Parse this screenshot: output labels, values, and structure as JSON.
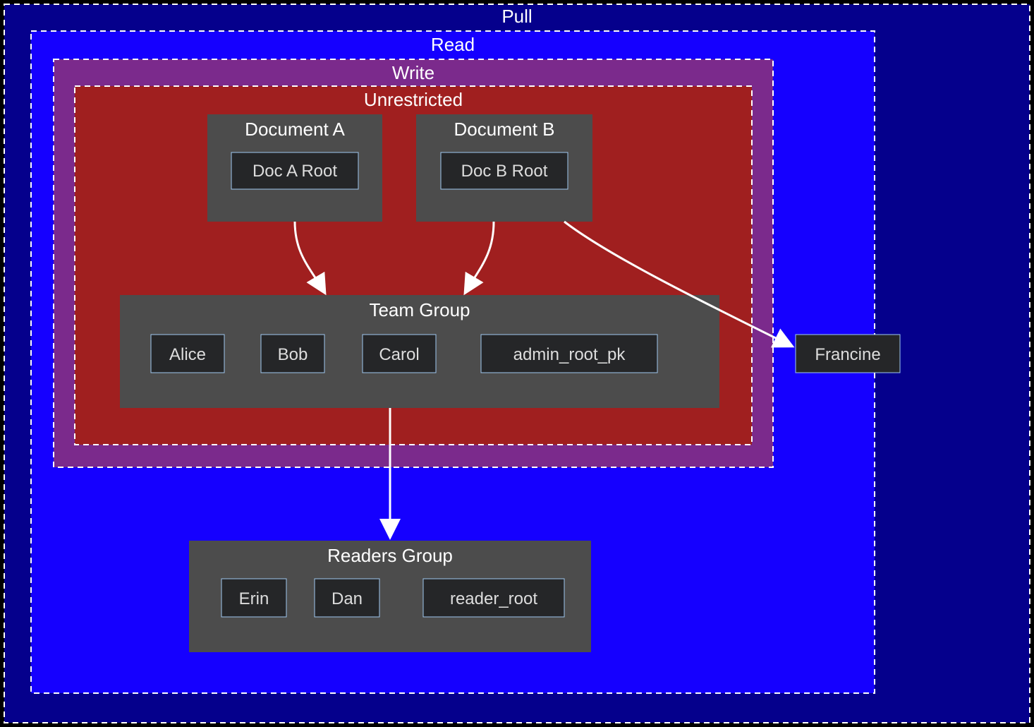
{
  "levels": {
    "pull": {
      "label": "Pull",
      "color": "#05008c"
    },
    "read": {
      "label": "Read",
      "color": "#1500ff"
    },
    "write": {
      "label": "Write",
      "color": "#7b2a8c"
    },
    "unrestricted": {
      "label": "Unrestricted",
      "color": "#a01f1f"
    }
  },
  "docA": {
    "title": "Document A",
    "root": "Doc A Root"
  },
  "docB": {
    "title": "Document B",
    "root": "Doc B Root"
  },
  "teamGroup": {
    "title": "Team Group",
    "members": [
      "Alice",
      "Bob",
      "Carol",
      "admin_root_pk"
    ]
  },
  "readersGroup": {
    "title": "Readers Group",
    "members": [
      "Erin",
      "Dan",
      "reader_root"
    ]
  },
  "external": {
    "francine": "Francine"
  }
}
